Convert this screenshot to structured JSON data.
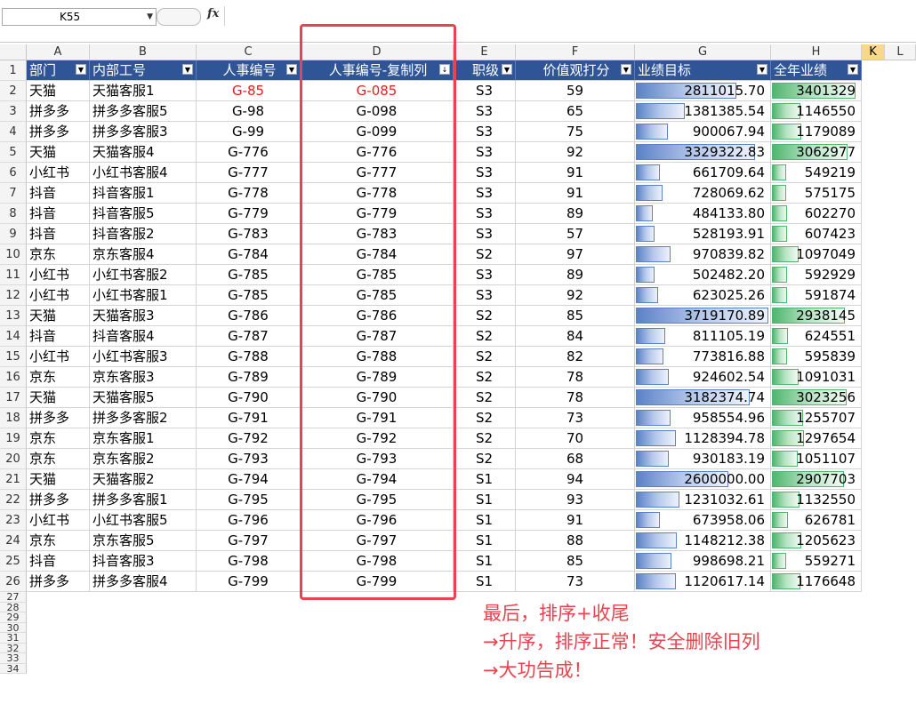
{
  "formula_bar": {
    "name_box": "K55",
    "fx": "fx",
    "content": ""
  },
  "columns": [
    {
      "letter": "A",
      "w": 71
    },
    {
      "letter": "B",
      "w": 120
    },
    {
      "letter": "C",
      "w": 117
    },
    {
      "letter": "D",
      "w": 172
    },
    {
      "letter": "E",
      "w": 70
    },
    {
      "letter": "F",
      "w": 134
    },
    {
      "letter": "G",
      "w": 153
    },
    {
      "letter": "H",
      "w": 102
    },
    {
      "letter": "K",
      "w": 26
    },
    {
      "letter": "L",
      "w": 35
    }
  ],
  "selected_column": "K",
  "headers": [
    "部门",
    "内部工号",
    "人事编号",
    "人事编号-复制列",
    "职级",
    "价值观打分",
    "业绩目标",
    "全年业绩"
  ],
  "rows": [
    {
      "dept": "天猫",
      "emp": "天猫客服1",
      "id": "G-85",
      "copy": "G-085",
      "level": "S3",
      "score": "59",
      "target": "2811015.70",
      "target_frac": 0.76,
      "annual": "3401329",
      "annual_frac": 0.96,
      "red": true
    },
    {
      "dept": "拼多多",
      "emp": "拼多多客服5",
      "id": "G-98",
      "copy": "G-098",
      "level": "S3",
      "score": "65",
      "target": "1381385.54",
      "target_frac": 0.37,
      "annual": "1146550",
      "annual_frac": 0.33
    },
    {
      "dept": "拼多多",
      "emp": "拼多多客服3",
      "id": "G-99",
      "copy": "G-099",
      "level": "S3",
      "score": "75",
      "target": "900067.94",
      "target_frac": 0.24,
      "annual": "1179089",
      "annual_frac": 0.34
    },
    {
      "dept": "天猫",
      "emp": "天猫客服4",
      "id": "G-776",
      "copy": "G-776",
      "level": "S3",
      "score": "92",
      "target": "3329322.83",
      "target_frac": 0.9,
      "annual": "3062977",
      "annual_frac": 0.87
    },
    {
      "dept": "小红书",
      "emp": "小红书客服4",
      "id": "G-777",
      "copy": "G-777",
      "level": "S3",
      "score": "91",
      "target": "661709.64",
      "target_frac": 0.18,
      "annual": "549219",
      "annual_frac": 0.16
    },
    {
      "dept": "抖音",
      "emp": "抖音客服1",
      "id": "G-778",
      "copy": "G-778",
      "level": "S3",
      "score": "91",
      "target": "728069.62",
      "target_frac": 0.2,
      "annual": "575175",
      "annual_frac": 0.16
    },
    {
      "dept": "抖音",
      "emp": "抖音客服5",
      "id": "G-779",
      "copy": "G-779",
      "level": "S3",
      "score": "89",
      "target": "484133.80",
      "target_frac": 0.13,
      "annual": "602270",
      "annual_frac": 0.17
    },
    {
      "dept": "抖音",
      "emp": "抖音客服2",
      "id": "G-783",
      "copy": "G-783",
      "level": "S3",
      "score": "57",
      "target": "528193.91",
      "target_frac": 0.14,
      "annual": "607423",
      "annual_frac": 0.17
    },
    {
      "dept": "京东",
      "emp": "京东客服4",
      "id": "G-784",
      "copy": "G-784",
      "level": "S2",
      "score": "97",
      "target": "970839.82",
      "target_frac": 0.26,
      "annual": "1097049",
      "annual_frac": 0.31
    },
    {
      "dept": "小红书",
      "emp": "小红书客服2",
      "id": "G-785",
      "copy": "G-785",
      "level": "S3",
      "score": "89",
      "target": "502482.20",
      "target_frac": 0.14,
      "annual": "592929",
      "annual_frac": 0.17
    },
    {
      "dept": "小红书",
      "emp": "小红书客服1",
      "id": "G-785",
      "copy": "G-785",
      "level": "S3",
      "score": "92",
      "target": "623025.26",
      "target_frac": 0.17,
      "annual": "591874",
      "annual_frac": 0.17
    },
    {
      "dept": "天猫",
      "emp": "天猫客服3",
      "id": "G-786",
      "copy": "G-786",
      "level": "S2",
      "score": "85",
      "target": "3719170.89",
      "target_frac": 1.0,
      "annual": "2938145",
      "annual_frac": 0.84
    },
    {
      "dept": "抖音",
      "emp": "抖音客服4",
      "id": "G-787",
      "copy": "G-787",
      "level": "S2",
      "score": "84",
      "target": "811105.19",
      "target_frac": 0.22,
      "annual": "624551",
      "annual_frac": 0.18
    },
    {
      "dept": "小红书",
      "emp": "小红书客服3",
      "id": "G-788",
      "copy": "G-788",
      "level": "S2",
      "score": "82",
      "target": "773816.88",
      "target_frac": 0.21,
      "annual": "595839",
      "annual_frac": 0.17
    },
    {
      "dept": "京东",
      "emp": "京东客服3",
      "id": "G-789",
      "copy": "G-789",
      "level": "S2",
      "score": "78",
      "target": "924602.54",
      "target_frac": 0.25,
      "annual": "1091031",
      "annual_frac": 0.31
    },
    {
      "dept": "天猫",
      "emp": "天猫客服5",
      "id": "G-790",
      "copy": "G-790",
      "level": "S2",
      "score": "78",
      "target": "3182374.74",
      "target_frac": 0.86,
      "annual": "3023256",
      "annual_frac": 0.86
    },
    {
      "dept": "拼多多",
      "emp": "拼多多客服2",
      "id": "G-791",
      "copy": "G-791",
      "level": "S2",
      "score": "73",
      "target": "958554.96",
      "target_frac": 0.26,
      "annual": "1255707",
      "annual_frac": 0.36
    },
    {
      "dept": "京东",
      "emp": "京东客服1",
      "id": "G-792",
      "copy": "G-792",
      "level": "S2",
      "score": "70",
      "target": "1128394.78",
      "target_frac": 0.3,
      "annual": "1297654",
      "annual_frac": 0.37
    },
    {
      "dept": "京东",
      "emp": "京东客服2",
      "id": "G-793",
      "copy": "G-793",
      "level": "S2",
      "score": "68",
      "target": "930183.19",
      "target_frac": 0.25,
      "annual": "1051107",
      "annual_frac": 0.3
    },
    {
      "dept": "天猫",
      "emp": "天猫客服2",
      "id": "G-794",
      "copy": "G-794",
      "level": "S1",
      "score": "94",
      "target": "2600000.00",
      "target_frac": 0.7,
      "annual": "2907703",
      "annual_frac": 0.83
    },
    {
      "dept": "拼多多",
      "emp": "拼多多客服1",
      "id": "G-795",
      "copy": "G-795",
      "level": "S1",
      "score": "93",
      "target": "1231032.61",
      "target_frac": 0.33,
      "annual": "1132550",
      "annual_frac": 0.32
    },
    {
      "dept": "小红书",
      "emp": "小红书客服5",
      "id": "G-796",
      "copy": "G-796",
      "level": "S1",
      "score": "91",
      "target": "673958.06",
      "target_frac": 0.18,
      "annual": "626781",
      "annual_frac": 0.18
    },
    {
      "dept": "京东",
      "emp": "京东客服5",
      "id": "G-797",
      "copy": "G-797",
      "level": "S1",
      "score": "88",
      "target": "1148212.38",
      "target_frac": 0.31,
      "annual": "1205623",
      "annual_frac": 0.34
    },
    {
      "dept": "抖音",
      "emp": "抖音客服3",
      "id": "G-798",
      "copy": "G-798",
      "level": "S1",
      "score": "85",
      "target": "998698.21",
      "target_frac": 0.27,
      "annual": "559271",
      "annual_frac": 0.16
    },
    {
      "dept": "拼多多",
      "emp": "拼多多客服4",
      "id": "G-799",
      "copy": "G-799",
      "level": "S1",
      "score": "73",
      "target": "1120617.14",
      "target_frac": 0.3,
      "annual": "1176648",
      "annual_frac": 0.33
    }
  ],
  "empty_rows": [
    "27",
    "28",
    "29",
    "30",
    "31",
    "32",
    "33",
    "34"
  ],
  "annotation": {
    "lines": [
      "最后，排序+收尾",
      "→升序，排序正常！安全删除旧列",
      "→大功告成！"
    ],
    "color": "#e8434e"
  },
  "colors": {
    "header_bg": "#2f5597",
    "highlight_red": "#e0201c",
    "bar_blue": "#5b82c6",
    "bar_green": "#4fb66e"
  }
}
